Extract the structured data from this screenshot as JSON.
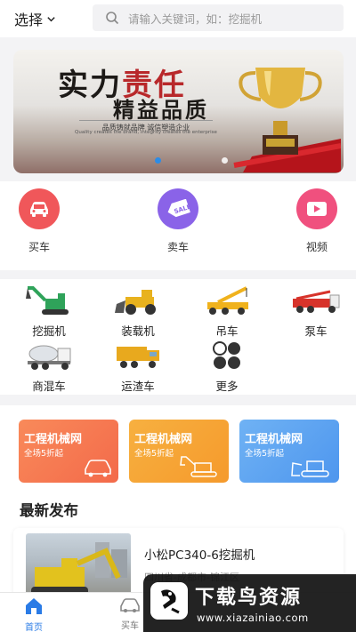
{
  "header": {
    "city_label": "选择",
    "search_placeholder": "请输入关键词，如：挖掘机"
  },
  "banner": {
    "slogan_line1_a": "实力",
    "slogan_line1_b": "责任",
    "slogan_line2_a": "精益",
    "slogan_line2_b": "品质",
    "subtitle_cn": "品质铸就品牌  诚信塑造企业",
    "subtitle_en": "Quality creates the brand, integrity creates the enterprise",
    "slide_count": 3,
    "active_slide": 1
  },
  "quick_actions": [
    {
      "label": "买车",
      "icon": "car-icon",
      "color": "#f0575a"
    },
    {
      "label": "卖车",
      "icon": "sale-tag-icon",
      "color": "#8a63e8"
    },
    {
      "label": "视频",
      "icon": "video-icon",
      "color": "#f0507e"
    }
  ],
  "categories": [
    {
      "label": "挖掘机",
      "icon": "excavator-icon"
    },
    {
      "label": "装载机",
      "icon": "loader-icon"
    },
    {
      "label": "吊车",
      "icon": "crane-icon"
    },
    {
      "label": "泵车",
      "icon": "pump-truck-icon"
    },
    {
      "label": "商混车",
      "icon": "mixer-truck-icon"
    },
    {
      "label": "运渣车",
      "icon": "dump-truck-icon"
    },
    {
      "label": "更多",
      "icon": "more-grid-icon"
    }
  ],
  "promos": [
    {
      "title": "工程机械网",
      "subtitle": "全场5折起",
      "icon": "car-outline-icon",
      "color_from": "#f98a5a",
      "color_to": "#f36a4a"
    },
    {
      "title": "工程机械网",
      "subtitle": "全场5折起",
      "icon": "excavator-outline-icon",
      "color_from": "#f7b040",
      "color_to": "#f59a2c"
    },
    {
      "title": "工程机械网",
      "subtitle": "全场5折起",
      "icon": "bulldozer-outline-icon",
      "color_from": "#6fb2f4",
      "color_to": "#4e96ee"
    }
  ],
  "latest": {
    "title": "最新发布",
    "items": [
      {
        "title": "小松PC340-6挖掘机",
        "location": "四川省-成都市-锦江区"
      }
    ]
  },
  "tabbar": {
    "tabs": [
      {
        "label": "首页",
        "icon": "home-icon",
        "active": true
      },
      {
        "label": "买车",
        "icon": "car-tab-icon",
        "active": false
      }
    ]
  },
  "watermark": {
    "name": "下载鸟资源",
    "url": "www.xiazainiao.com"
  }
}
